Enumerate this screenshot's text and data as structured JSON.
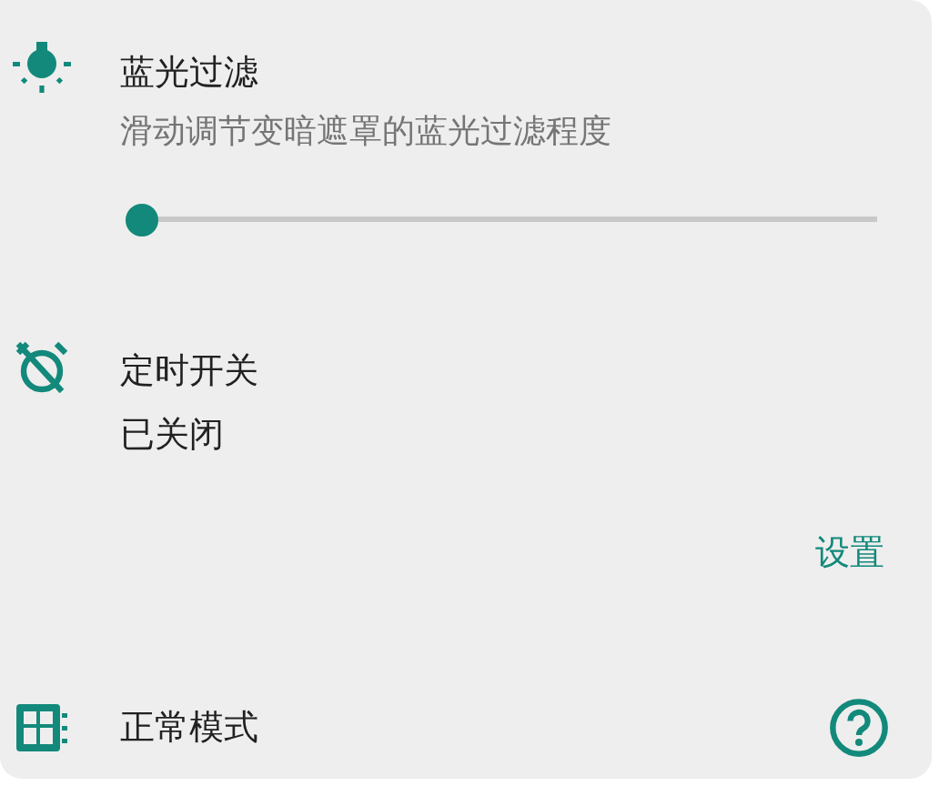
{
  "blue_light_filter": {
    "title": "蓝光过滤",
    "description": "滑动调节变暗遮罩的蓝光过滤程度",
    "slider": {
      "level": 0
    }
  },
  "timer": {
    "title": "定时开关",
    "status": "已关闭",
    "action": "设置"
  },
  "mode": {
    "label": "正常模式"
  }
}
